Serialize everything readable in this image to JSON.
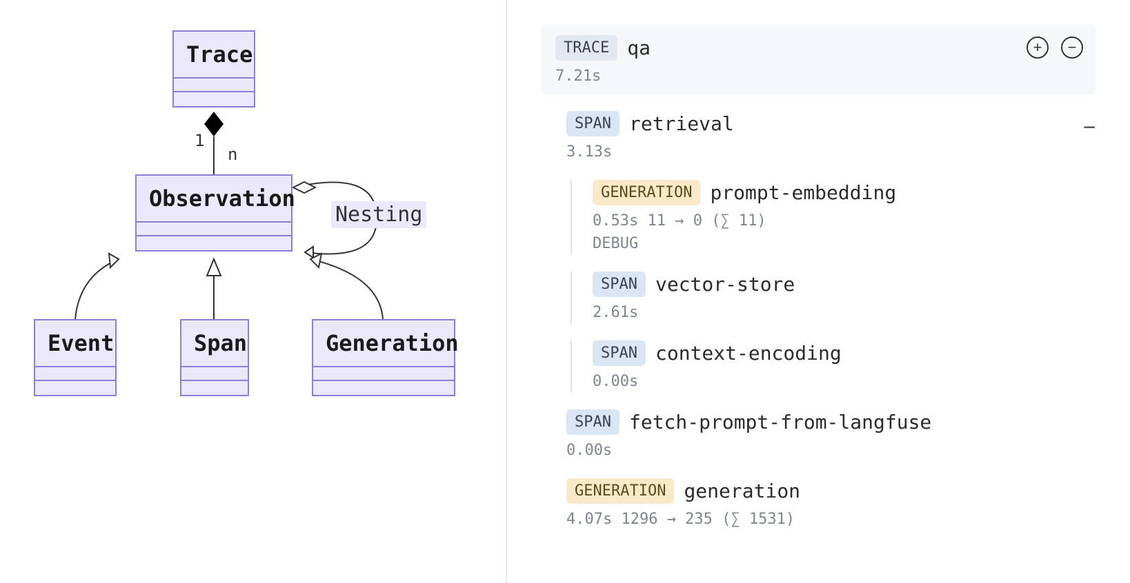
{
  "diagram": {
    "boxes": {
      "trace": "Trace",
      "observation": "Observation",
      "event": "Event",
      "span": "Span",
      "generation": "Generation"
    },
    "labels": {
      "one": "1",
      "many": "n",
      "nesting": "Nesting"
    }
  },
  "trace": {
    "badge": "TRACE",
    "name": "qa",
    "duration": "7.21s",
    "nodes": [
      {
        "badge": "SPAN",
        "badge_kind": "span",
        "name": "retrieval",
        "duration": "3.13s",
        "collapsible": true,
        "children": [
          {
            "badge": "GENERATION",
            "badge_kind": "gen",
            "name": "prompt-embedding",
            "duration": "0.53s",
            "tokens": "11 → 0 (∑ 11)",
            "extra": "DEBUG"
          },
          {
            "badge": "SPAN",
            "badge_kind": "span",
            "name": "vector-store",
            "duration": "2.61s"
          },
          {
            "badge": "SPAN",
            "badge_kind": "span",
            "name": "context-encoding",
            "duration": "0.00s"
          }
        ]
      },
      {
        "badge": "SPAN",
        "badge_kind": "span",
        "name": "fetch-prompt-from-langfuse",
        "duration": "0.00s"
      },
      {
        "badge": "GENERATION",
        "badge_kind": "gen",
        "name": "generation",
        "duration": "4.07s",
        "tokens": "1296 → 235 (∑ 1531)"
      }
    ]
  },
  "icons": {
    "plus": "+",
    "minus": "−",
    "collapse": "−"
  }
}
